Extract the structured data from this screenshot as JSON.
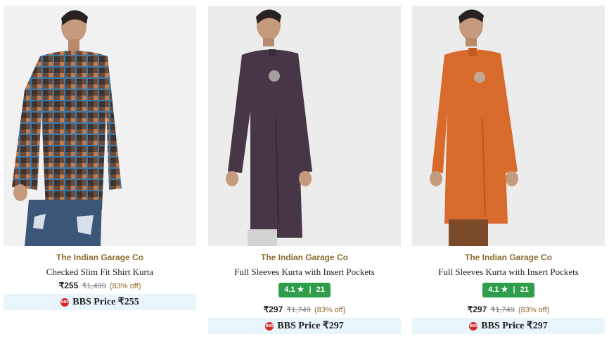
{
  "products": [
    {
      "brand": "The Indian Garage Co",
      "name": "Checked Slim Fit Shirt Kurta",
      "price": "₹255",
      "mrp": "₹1,499",
      "discount": "(83% off)",
      "rating": null,
      "bbs_label": "BBS Price ₹255"
    },
    {
      "brand": "The Indian Garage Co",
      "name": "Full Sleeves Kurta with Insert Pockets",
      "price": "₹297",
      "mrp": "₹1,749",
      "discount": "(83% off)",
      "rating": {
        "score": "4.1",
        "star": "★",
        "separator": "|",
        "count": "21"
      },
      "bbs_label": "BBS Price ₹297"
    },
    {
      "brand": "The Indian Garage Co",
      "name": "Full Sleeves Kurta with Insert Pockets",
      "price": "₹297",
      "mrp": "₹1,749",
      "discount": "(83% off)",
      "rating": {
        "score": "4.1",
        "star": "★",
        "separator": "|",
        "count": "21"
      },
      "bbs_label": "BBS Price ₹297"
    }
  ],
  "bbs_icon_text": "BBS",
  "colors": {
    "brand_text": "#8b6a2e",
    "rating_badge": "#2e9e4a",
    "bbs_strip": "#e8f5fb",
    "bbs_icon": "#d62828",
    "kurta_purple": "#463646",
    "kurta_orange": "#d86a2c",
    "shirt_checked": "#6a4a3a"
  }
}
